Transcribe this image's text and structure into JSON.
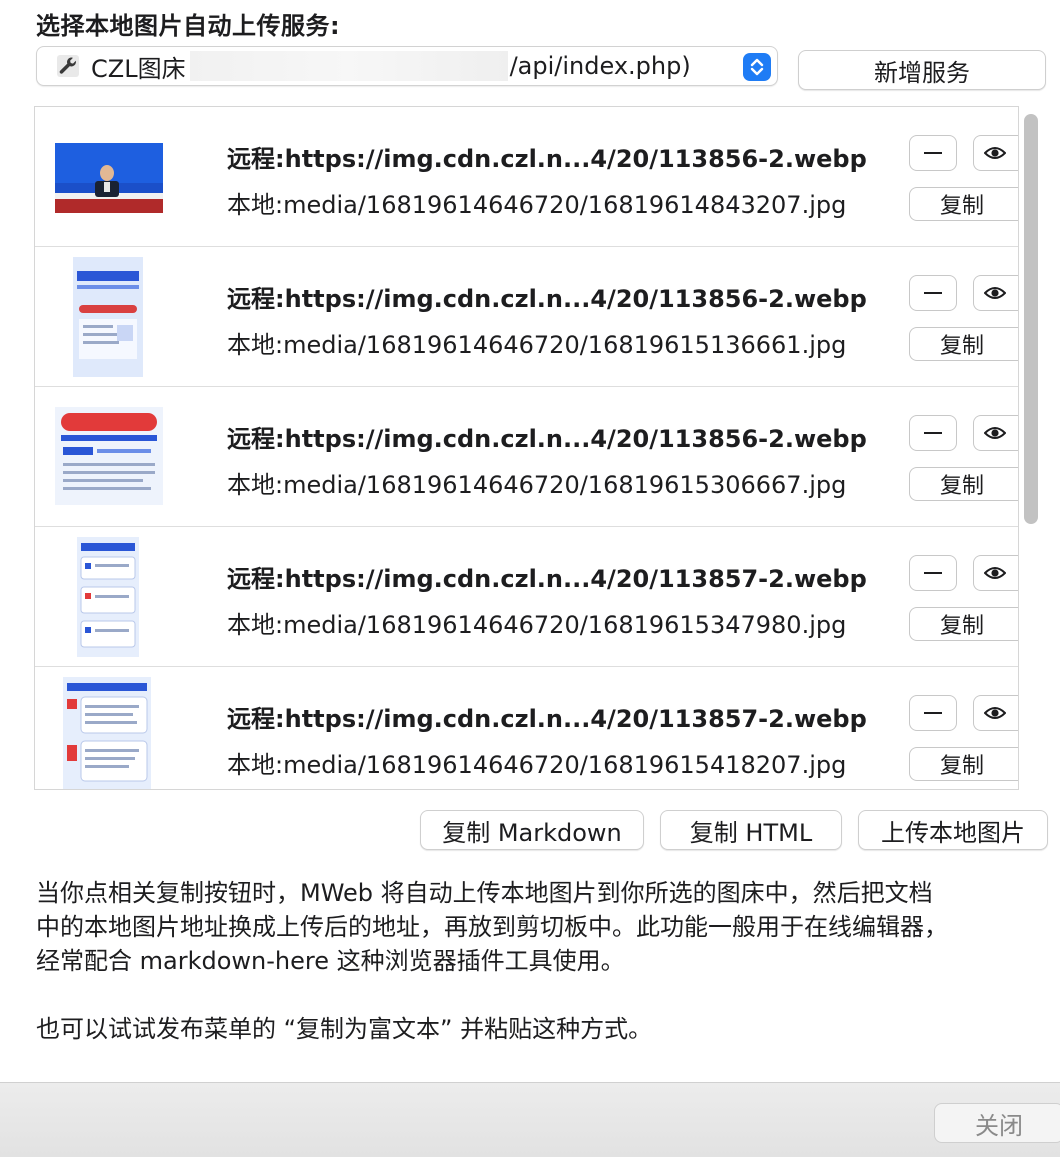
{
  "title": "选择本地图片自动上传服务:",
  "service_select": {
    "name": "CZL图床",
    "url_suffix": "/api/index.php)",
    "icon": "wrench-icon"
  },
  "add_service_label": "新增服务",
  "image_list": {
    "remote_label": "远程:",
    "local_label": "本地:",
    "copy_label": "复制",
    "items": [
      {
        "remote": "https://img.cdn.czl.n...4/20/113856-2.webp",
        "local": "media/16819614646720/16819614843207.jpg",
        "thumb": "press-conference-photo"
      },
      {
        "remote": "https://img.cdn.czl.n...4/20/113856-2.webp",
        "local": "media/16819614646720/16819615136661.jpg",
        "thumb": "infographic-blue-poster"
      },
      {
        "remote": "https://img.cdn.czl.n...4/20/113856-2.webp",
        "local": "media/16819614646720/16819615306667.jpg",
        "thumb": "infographic-red-banner"
      },
      {
        "remote": "https://img.cdn.czl.n...4/20/113857-2.webp",
        "local": "media/16819614646720/16819615347980.jpg",
        "thumb": "infographic-list-cards"
      },
      {
        "remote": "https://img.cdn.czl.n...4/20/113857-2.webp",
        "local": "media/16819614646720/16819615418207.jpg",
        "thumb": "infographic-list-cards-2"
      }
    ]
  },
  "actions": {
    "copy_markdown": "复制 Markdown",
    "copy_html": "复制 HTML",
    "upload_local": "上传本地图片"
  },
  "description": {
    "paragraph1_line1": "当你点相关复制按钮时，MWeb 将自动上传本地图片到你所选的图床中，然后把文档",
    "paragraph1_line2": "中的本地图片地址换成上传后的地址，再放到剪切板中。此功能一般用于在线编辑器，",
    "paragraph1_line3": "经常配合 markdown-here 这种浏览器插件工具使用。",
    "paragraph2": "也可以试试发布菜单的 “复制为富文本” 并粘贴这种方式。"
  },
  "footer": {
    "close_label": "关闭"
  },
  "colors": {
    "accent": "#1f7cf5",
    "text": "#1d1d1f",
    "border": "#d6d6d6"
  }
}
